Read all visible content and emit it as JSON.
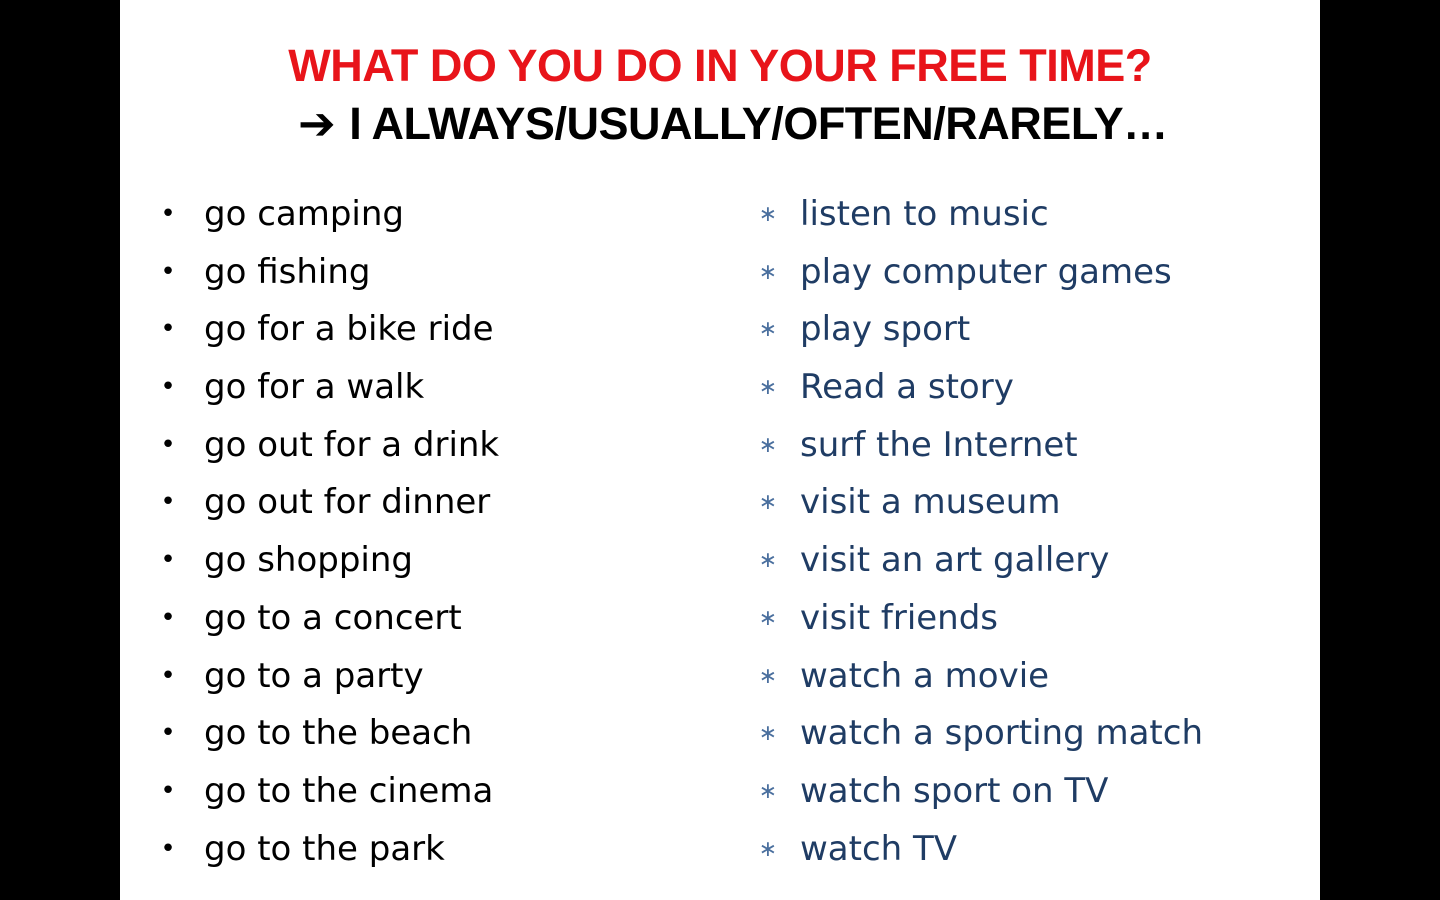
{
  "title": {
    "text": "WHAT DO YOU DO IN YOUR FREE TIME?",
    "color": "#e8141a"
  },
  "subtitle": {
    "arrow": "➔",
    "text": "I ALWAYS/USUALLY/OFTEN/RARELY…"
  },
  "left_list": {
    "bullet": "•",
    "items": [
      "go camping",
      "go fishing",
      "go for a bike ride",
      "go for a walk",
      "go out for a drink",
      "go out for dinner",
      "go shopping",
      "go to a concert",
      "go to a party",
      "go to the beach",
      "go to the cinema",
      "go to the park"
    ]
  },
  "right_list": {
    "bullet": "∗",
    "color": "#1f3c64",
    "bullet_color": "#4a6f9e",
    "items": [
      "listen to music",
      "play computer games",
      "play sport",
      "Read a story",
      "surf the Internet",
      "visit a museum",
      "visit an art gallery",
      "visit friends",
      "watch a movie",
      "watch a sporting match",
      "watch sport on TV",
      "watch TV"
    ]
  }
}
